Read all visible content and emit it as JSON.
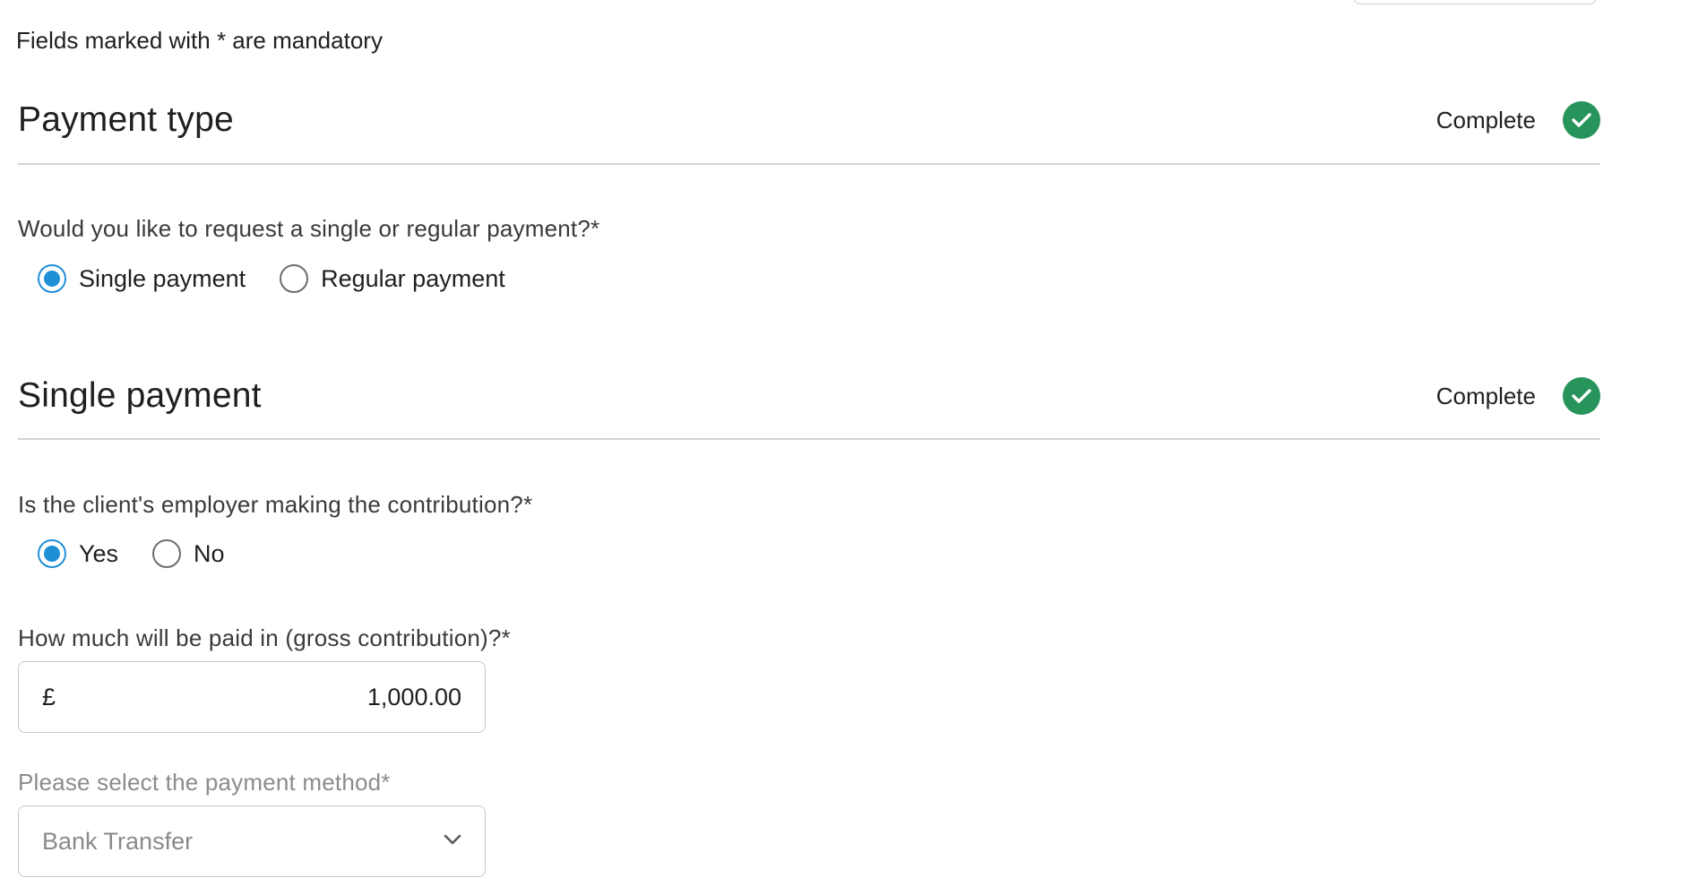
{
  "form": {
    "mandatory_note": "Fields marked with * are mandatory"
  },
  "payment_type": {
    "title": "Payment type",
    "status": "Complete",
    "question": "Would you like to request a single or regular payment?*",
    "options": [
      {
        "label": "Single payment",
        "selected": true
      },
      {
        "label": "Regular payment",
        "selected": false
      }
    ]
  },
  "single_payment": {
    "title": "Single payment",
    "status": "Complete",
    "employer_question": "Is the client's employer making the contribution?*",
    "employer_options": [
      {
        "label": "Yes",
        "selected": true
      },
      {
        "label": "No",
        "selected": false
      }
    ],
    "amount_question": "How much will be paid in (gross contribution)?*",
    "currency_symbol": "£",
    "amount_value": "1,000.00",
    "method_question": "Please select the payment method*",
    "method_value": "Bank Transfer"
  },
  "icons": {
    "status_icon": "check-circle-icon",
    "dropdown_icon": "chevron-down-icon"
  },
  "colors": {
    "accent": "#1f8fd6",
    "complete": "#27945c",
    "muted_text": "#8c8c8c"
  }
}
